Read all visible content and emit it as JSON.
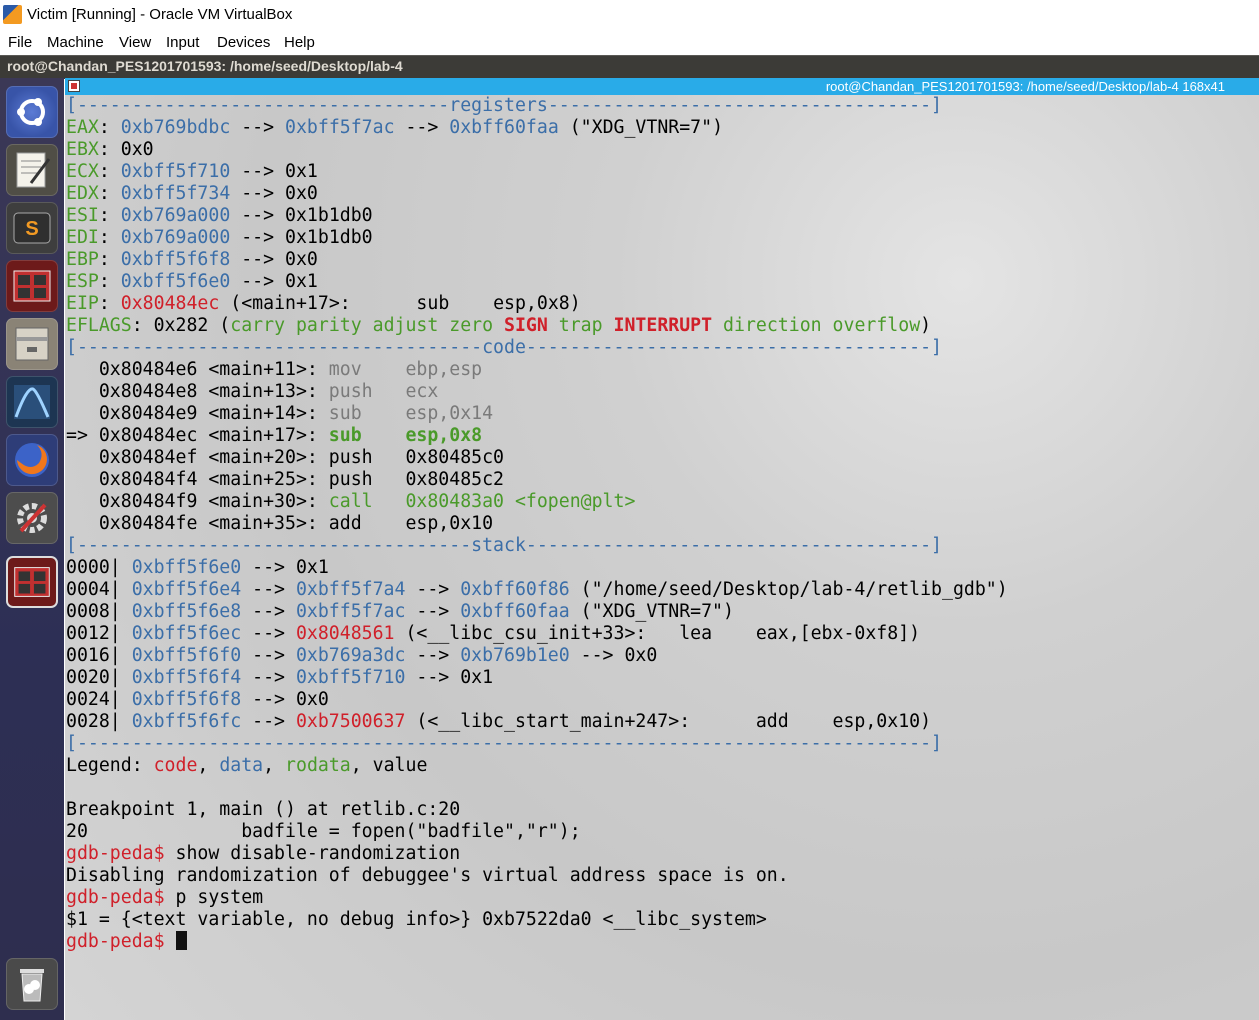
{
  "window": {
    "title": "Victim [Running] - Oracle VM VirtualBox",
    "menu": [
      "File",
      "Machine",
      "View",
      "Input",
      "Devices",
      "Help"
    ]
  },
  "ubuntu_bar": {
    "title": "root@Chandan_PES1201701593: /home/seed/Desktop/lab-4"
  },
  "terminal": {
    "title": "root@Chandan_PES1201701593: /home/seed/Desktop/lab-4 168x41",
    "lines": [
      [
        {
          "t": "[----------------------------------",
          "c": "blue"
        },
        {
          "t": "registers",
          "c": "blue"
        },
        {
          "t": "-----------------------------------]",
          "c": "blue"
        }
      ],
      [
        {
          "t": "EAX",
          "c": "green"
        },
        {
          "t": ": "
        },
        {
          "t": "0xb769bdbc",
          "c": "blue"
        },
        {
          "t": " --> "
        },
        {
          "t": "0xbff5f7ac",
          "c": "blue"
        },
        {
          "t": " --> "
        },
        {
          "t": "0xbff60faa",
          "c": "blue"
        },
        {
          "t": " (\"XDG_VTNR=7\")"
        }
      ],
      [
        {
          "t": "EBX",
          "c": "green"
        },
        {
          "t": ": 0x0"
        }
      ],
      [
        {
          "t": "ECX",
          "c": "green"
        },
        {
          "t": ": "
        },
        {
          "t": "0xbff5f710",
          "c": "blue"
        },
        {
          "t": " --> 0x1"
        }
      ],
      [
        {
          "t": "EDX",
          "c": "green"
        },
        {
          "t": ": "
        },
        {
          "t": "0xbff5f734",
          "c": "blue"
        },
        {
          "t": " --> 0x0"
        }
      ],
      [
        {
          "t": "ESI",
          "c": "green"
        },
        {
          "t": ": "
        },
        {
          "t": "0xb769a000",
          "c": "blue"
        },
        {
          "t": " --> 0x1b1db0"
        }
      ],
      [
        {
          "t": "EDI",
          "c": "green"
        },
        {
          "t": ": "
        },
        {
          "t": "0xb769a000",
          "c": "blue"
        },
        {
          "t": " --> 0x1b1db0"
        }
      ],
      [
        {
          "t": "EBP",
          "c": "green"
        },
        {
          "t": ": "
        },
        {
          "t": "0xbff5f6f8",
          "c": "blue"
        },
        {
          "t": " --> 0x0"
        }
      ],
      [
        {
          "t": "ESP",
          "c": "green"
        },
        {
          "t": ": "
        },
        {
          "t": "0xbff5f6e0",
          "c": "blue"
        },
        {
          "t": " --> 0x1"
        }
      ],
      [
        {
          "t": "EIP",
          "c": "green"
        },
        {
          "t": ": "
        },
        {
          "t": "0x80484ec",
          "c": "red"
        },
        {
          "t": " (<main+17>:      sub    esp,0x8)"
        }
      ],
      [
        {
          "t": "EFLAGS",
          "c": "green"
        },
        {
          "t": ": 0x282 ("
        },
        {
          "t": "carry parity adjust zero ",
          "c": "green"
        },
        {
          "t": "SIGN",
          "c": "redb"
        },
        {
          "t": " trap ",
          "c": "green"
        },
        {
          "t": "INTERRUPT",
          "c": "redb"
        },
        {
          "t": " direction overflow",
          "c": "green"
        },
        {
          "t": ")"
        }
      ],
      [
        {
          "t": "[-------------------------------------",
          "c": "blue"
        },
        {
          "t": "code",
          "c": "blue"
        },
        {
          "t": "-------------------------------------]",
          "c": "blue"
        }
      ],
      [
        {
          "t": "   0x80484e6 <main+11>: "
        },
        {
          "t": "mov    ebp,esp",
          "c": "gray"
        }
      ],
      [
        {
          "t": "   0x80484e8 <main+13>: "
        },
        {
          "t": "push   ecx",
          "c": "gray"
        }
      ],
      [
        {
          "t": "   0x80484e9 <main+14>: "
        },
        {
          "t": "sub    esp,0x14",
          "c": "gray"
        }
      ],
      [
        {
          "t": "=> 0x80484ec <main+17>: "
        },
        {
          "t": "sub    esp,0x8",
          "c": "greenb"
        }
      ],
      [
        {
          "t": "   0x80484ef <main+20>: push   0x80485c0"
        }
      ],
      [
        {
          "t": "   0x80484f4 <main+25>: push   0x80485c2"
        }
      ],
      [
        {
          "t": "   0x80484f9 <main+30>: "
        },
        {
          "t": "call   0x80483a0 <fopen@plt>",
          "c": "green"
        }
      ],
      [
        {
          "t": "   0x80484fe <main+35>: add    esp,0x10"
        }
      ],
      [
        {
          "t": "[------------------------------------",
          "c": "blue"
        },
        {
          "t": "stack",
          "c": "blue"
        },
        {
          "t": "-------------------------------------]",
          "c": "blue"
        }
      ],
      [
        {
          "t": "0000| "
        },
        {
          "t": "0xbff5f6e0",
          "c": "blue"
        },
        {
          "t": " --> 0x1"
        }
      ],
      [
        {
          "t": "0004| "
        },
        {
          "t": "0xbff5f6e4",
          "c": "blue"
        },
        {
          "t": " --> "
        },
        {
          "t": "0xbff5f7a4",
          "c": "blue"
        },
        {
          "t": " --> "
        },
        {
          "t": "0xbff60f86",
          "c": "blue"
        },
        {
          "t": " (\"/home/seed/Desktop/lab-4/retlib_gdb\")"
        }
      ],
      [
        {
          "t": "0008| "
        },
        {
          "t": "0xbff5f6e8",
          "c": "blue"
        },
        {
          "t": " --> "
        },
        {
          "t": "0xbff5f7ac",
          "c": "blue"
        },
        {
          "t": " --> "
        },
        {
          "t": "0xbff60faa",
          "c": "blue"
        },
        {
          "t": " (\"XDG_VTNR=7\")"
        }
      ],
      [
        {
          "t": "0012| "
        },
        {
          "t": "0xbff5f6ec",
          "c": "blue"
        },
        {
          "t": " --> "
        },
        {
          "t": "0x8048561",
          "c": "red"
        },
        {
          "t": " (<__libc_csu_init+33>:   lea    eax,[ebx-0xf8])"
        }
      ],
      [
        {
          "t": "0016| "
        },
        {
          "t": "0xbff5f6f0",
          "c": "blue"
        },
        {
          "t": " --> "
        },
        {
          "t": "0xb769a3dc",
          "c": "blue"
        },
        {
          "t": " --> "
        },
        {
          "t": "0xb769b1e0",
          "c": "blue"
        },
        {
          "t": " --> 0x0"
        }
      ],
      [
        {
          "t": "0020| "
        },
        {
          "t": "0xbff5f6f4",
          "c": "blue"
        },
        {
          "t": " --> "
        },
        {
          "t": "0xbff5f710",
          "c": "blue"
        },
        {
          "t": " --> 0x1"
        }
      ],
      [
        {
          "t": "0024| "
        },
        {
          "t": "0xbff5f6f8",
          "c": "blue"
        },
        {
          "t": " --> 0x0"
        }
      ],
      [
        {
          "t": "0028| "
        },
        {
          "t": "0xbff5f6fc",
          "c": "blue"
        },
        {
          "t": " --> "
        },
        {
          "t": "0xb7500637",
          "c": "red"
        },
        {
          "t": " (<__libc_start_main+247>:      add    esp,0x10)"
        }
      ],
      [
        {
          "t": "[------------------------------------------------------------------------------]",
          "c": "blue"
        }
      ],
      [
        {
          "t": "Legend: "
        },
        {
          "t": "code",
          "c": "red"
        },
        {
          "t": ", "
        },
        {
          "t": "data",
          "c": "blue"
        },
        {
          "t": ", "
        },
        {
          "t": "rodata",
          "c": "green"
        },
        {
          "t": ", value"
        }
      ],
      [
        {
          "t": ""
        }
      ],
      [
        {
          "t": "Breakpoint 1, main () at retlib.c:20"
        }
      ],
      [
        {
          "t": "20              badfile = fopen(\"badfile\",\"r\");"
        }
      ],
      [
        {
          "t": "gdb-peda$",
          "c": "red"
        },
        {
          "t": " show disable-randomization"
        }
      ],
      [
        {
          "t": "Disabling randomization of debuggee's virtual address space is on."
        }
      ],
      [
        {
          "t": "gdb-peda$",
          "c": "red"
        },
        {
          "t": " p system"
        }
      ],
      [
        {
          "t": "$1 = {<text variable, no debug info>} 0xb7522da0 <__libc_system>"
        }
      ],
      [
        {
          "t": "gdb-peda$",
          "c": "red"
        },
        {
          "t": " "
        }
      ]
    ]
  },
  "launcher": {
    "items": [
      {
        "name": "ubuntu-dash-icon",
        "color": "#d9d9e8"
      },
      {
        "name": "text-editor-icon",
        "color": "#6e6c62"
      },
      {
        "name": "sublime-text-icon",
        "color": "#4b4b4b"
      },
      {
        "name": "terminal-app-icon",
        "color": "#8c1f1f"
      },
      {
        "name": "file-manager-icon",
        "color": "#a59d8f"
      },
      {
        "name": "wireshark-icon",
        "color": "#1f3b5e"
      },
      {
        "name": "firefox-icon",
        "color": "#2e3d78"
      },
      {
        "name": "settings-icon",
        "color": "#5d5d5d"
      },
      {
        "name": "terminal-active-icon",
        "color": "#8c1f1f"
      },
      {
        "name": "trash-icon",
        "color": "#575757"
      }
    ]
  }
}
